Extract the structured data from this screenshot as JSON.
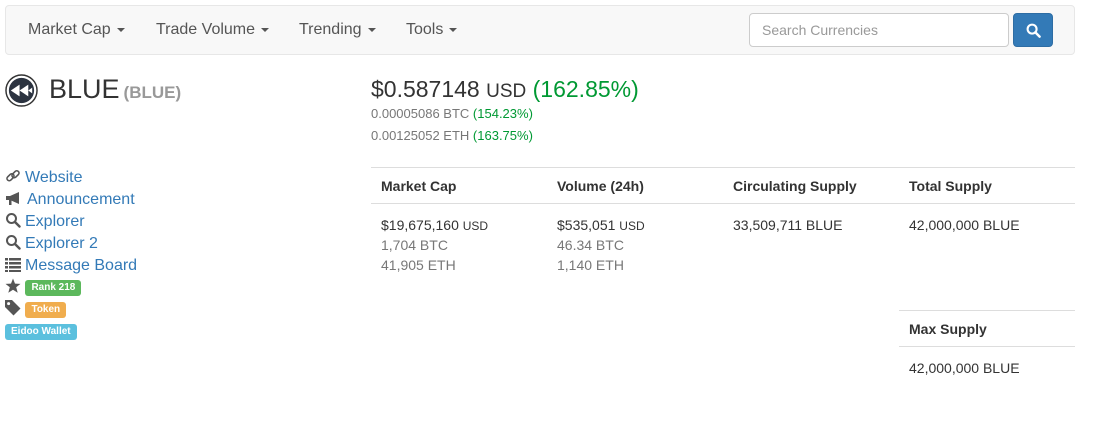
{
  "nav": {
    "items": [
      "Market Cap",
      "Trade Volume",
      "Trending",
      "Tools"
    ],
    "search_placeholder": "Search Currencies"
  },
  "coin": {
    "name": "BLUE",
    "symbol": "(BLUE)"
  },
  "price": {
    "usd": "$0.587148",
    "usd_unit": "USD",
    "usd_change": "(162.85%)",
    "btc": "0.00005086 BTC",
    "btc_change": "(154.23%)",
    "eth": "0.00125052 ETH",
    "eth_change": "(163.75%)"
  },
  "links": {
    "website": "Website",
    "announcement": "Announcement",
    "explorer": "Explorer",
    "explorer2": "Explorer 2",
    "message_board": "Message Board",
    "rank": "Rank 218",
    "token": "Token",
    "wallet": "Eidoo Wallet"
  },
  "stats": {
    "market_cap": {
      "label": "Market Cap",
      "usd": "$19,675,160",
      "usd_unit": "USD",
      "btc": "1,704 BTC",
      "eth": "41,905 ETH"
    },
    "volume": {
      "label": "Volume (24h)",
      "usd": "$535,051",
      "usd_unit": "USD",
      "btc": "46.34 BTC",
      "eth": "1,140 ETH"
    },
    "circulating": {
      "label": "Circulating Supply",
      "value": "33,509,711 BLUE"
    },
    "total": {
      "label": "Total Supply",
      "value": "42,000,000 BLUE"
    },
    "max": {
      "label": "Max Supply",
      "value": "42,000,000 BLUE"
    }
  },
  "colors": {
    "link": "#337ab7",
    "positive": "#009933",
    "rank_badge": "#5cb85c",
    "token_badge": "#f0ad4e",
    "wallet_badge": "#5bc0de"
  }
}
